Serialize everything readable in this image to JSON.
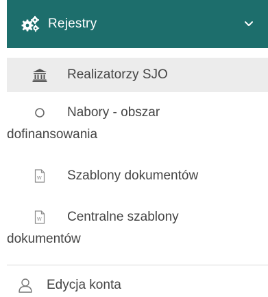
{
  "header": {
    "title": "Rejestry",
    "icon": "cogs-icon",
    "toggle_icon": "chevron-down-icon",
    "background": "#1d6e6c",
    "text_color": "#ffffff"
  },
  "submenu": {
    "items": [
      {
        "label": "Realizatorzy SJO",
        "icon": "bank-icon",
        "active": true
      },
      {
        "label_line1": "Nabory - obszar",
        "label_line2": "dofinansowania",
        "icon": "circle-icon"
      },
      {
        "label": "Szablony dokumentów",
        "icon": "word-document-icon"
      },
      {
        "label_line1": "Centralne szablony",
        "label_line2": "dokumentów",
        "icon": "word-document-icon"
      }
    ],
    "active_background": "#ececec"
  },
  "account": {
    "label": "Edycja konta",
    "icon": "user-icon"
  }
}
